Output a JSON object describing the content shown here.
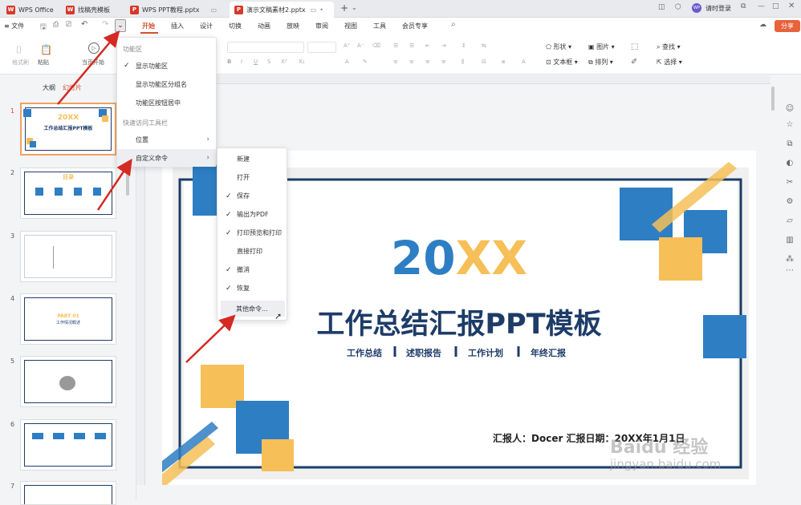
{
  "tabs": [
    {
      "label": "WPS Office",
      "color": "#d9372a"
    },
    {
      "label": "找稿壳模板",
      "color": "#d9372a"
    },
    {
      "label": "WPS PPT教程.pptx",
      "color": "#d9372a"
    },
    {
      "label": "演示文稿素材2.pptx",
      "color": "#d9372a"
    }
  ],
  "titlebar": {
    "user_label": "请时登录",
    "avatar_text": "WP",
    "add_tab": "+"
  },
  "menubar": {
    "file_label": "≡ 文件",
    "tabs": [
      "开始",
      "插入",
      "设计",
      "切换",
      "动画",
      "放映",
      "审阅",
      "视图",
      "工具",
      "会员专享"
    ],
    "active_tab": "开始",
    "share_label": "分享"
  },
  "ribbon": {
    "format_painter": "格式刷",
    "paste": "粘贴",
    "current_start": "当页开始",
    "shape": "形状",
    "picture": "图片",
    "textbox": "文本框",
    "arrange": "排列",
    "find": "查找",
    "select": "选择"
  },
  "panel_tabs": {
    "outline": "大纲",
    "slides": "幻灯片"
  },
  "thumbnails": [
    {
      "num": "1",
      "title": "20XX",
      "subtitle": "工作总结汇报PPT模板"
    },
    {
      "num": "2",
      "title": "目录"
    },
    {
      "num": "3"
    },
    {
      "num": "4",
      "title": "PART 01",
      "subtitle": "工作情况概述"
    },
    {
      "num": "5"
    },
    {
      "num": "6"
    },
    {
      "num": "7"
    }
  ],
  "menu1": {
    "section1": "功能区",
    "item1": "显示功能区",
    "item2": "显示功能区分组名",
    "item3": "功能区按钮居中",
    "section2": "快速访问工具栏",
    "item4": "位置",
    "item5": "自定义命令"
  },
  "menu2": {
    "items": [
      "新建",
      "打开",
      "保存",
      "输出为PDF",
      "打印预览和打印",
      "直接打印",
      "撤消",
      "恢复",
      "其他命令..."
    ],
    "checked": [
      false,
      false,
      true,
      true,
      true,
      false,
      true,
      true,
      false
    ]
  },
  "slide": {
    "year_a": "20",
    "year_b": "XX",
    "title": "工作总结汇报PPT模板",
    "tags": [
      "工作总结",
      "述职报告",
      "工作计划",
      "年终汇报"
    ],
    "reporter": "汇报人：Docer  汇报日期：20XX年1月1日"
  },
  "colors": {
    "accent": "#d4502f",
    "blue": "#2e7ec4",
    "yellow": "#f6bf57",
    "navy": "#1d3c68",
    "arrow": "#d42a23"
  },
  "watermark": {
    "brand": "Baidu 经验",
    "url": "jingyan.baidu.com"
  }
}
